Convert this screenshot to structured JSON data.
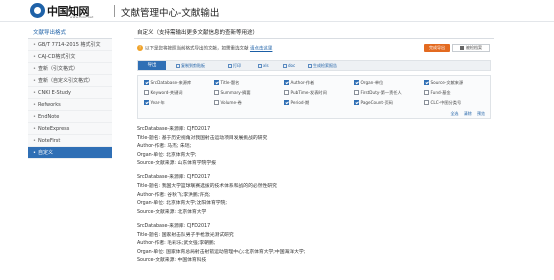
{
  "header": {
    "logo_cn": "中国知网",
    "logo_sub": "www.cnki.net",
    "title": "文献管理中心-文献输出"
  },
  "sidebar": {
    "title": "文献导出格式",
    "items": [
      {
        "label": "GB/T 7714-2015 格式引文"
      },
      {
        "label": "CAJ-CD格式引文"
      },
      {
        "label": "查新（引文格式）"
      },
      {
        "label": "查新（自定义引文格式）"
      },
      {
        "label": "CNKI E-Study"
      },
      {
        "label": "Refworks"
      },
      {
        "label": "EndNote"
      },
      {
        "label": "NoteExpress"
      },
      {
        "label": "NoteFirst"
      },
      {
        "label": "自定义",
        "active": true
      }
    ]
  },
  "main": {
    "title": "自定义（支持需输出更多文献信息的查新等用途）",
    "tip_text": "以下是您将按照当前格式导出的文献，如需重选文献",
    "tip_link": "请点击这里",
    "export_btn": "完成导出",
    "batch_btn": "被检档案",
    "toolbar": {
      "export": "导出",
      "copy": "复制到剪贴板",
      "print": "打印",
      "xls": "xls",
      "doc": "doc",
      "report": "生成检索报告"
    },
    "fields": [
      {
        "label": "SrcDatabase-来源库",
        "checked": true
      },
      {
        "label": "Title-题名",
        "checked": true
      },
      {
        "label": "Author-作者",
        "checked": true
      },
      {
        "label": "Organ-单位",
        "checked": true
      },
      {
        "label": "Source-文献来源",
        "checked": true
      },
      {
        "label": "Keyword-关键词",
        "checked": false
      },
      {
        "label": "Summary-摘要",
        "checked": false
      },
      {
        "label": "PubTime-发表时间",
        "checked": false
      },
      {
        "label": "FirstDuty-第一责任人",
        "checked": false
      },
      {
        "label": "Fund-基金",
        "checked": false
      },
      {
        "label": "Year-年",
        "checked": true
      },
      {
        "label": "Volume-卷",
        "checked": false
      },
      {
        "label": "Period-期",
        "checked": true
      },
      {
        "label": "PageCount-页码",
        "checked": true
      },
      {
        "label": "CLC-中图分类号",
        "checked": false
      }
    ],
    "field_actions": [
      "全选",
      "清除",
      "预览"
    ],
    "records": [
      {
        "lines": [
          "SrcDatabase-来源库: CJFD2017",
          "Title-题名: 基于历史视角对我国射击运动项目发展挑战的研究",
          "Author-作者: 马杰; 朱瑶;",
          "Organ-单位: 北京体育大学;",
          "Source-文献来源: 山东体育学院学报"
        ]
      },
      {
        "lines": [
          "SrcDatabase-来源库: CJFD2017",
          "Title-题名: 我国大学篮球联赛选拔的技术体系和战的的必然性研究",
          "Author-作者: 谷秋飞;李洪鹏;许亮;",
          "Organ-单位: 北京体育大学;沈阳体育学院;",
          "Source-文献来源: 北京体育大学"
        ]
      },
      {
        "lines": [
          "SrcDatabase-来源库: CJFD2017",
          "Title-题名: 国家射击队男子手枪激光测试研究",
          "Author-作者: 毛彩乐;武文强;李朝鹏;",
          "Organ-单位: 国家体育总局射击射箭运动管理中心;北京体育大学;中国海洋大学;",
          "Source-文献来源: 中国体育科技"
        ]
      }
    ]
  },
  "colors": {
    "accent": "#2f6fb5",
    "export_orange": "#e36a20",
    "link": "#1b5fa6"
  }
}
